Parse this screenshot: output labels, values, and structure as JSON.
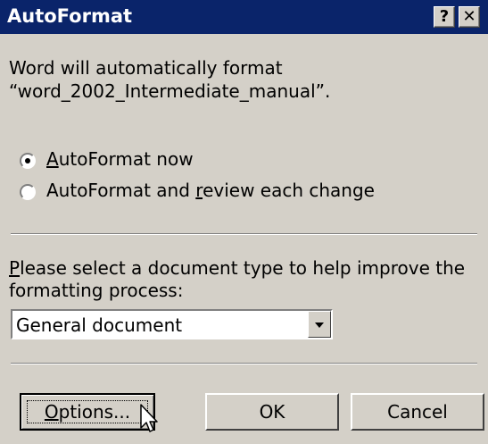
{
  "window": {
    "title": "AutoFormat",
    "help_label": "?",
    "close_label": "✕"
  },
  "intro": {
    "line1": "Word will automatically format",
    "line2": "“word_2002_Intermediate_manual”."
  },
  "options": [
    {
      "pre": "",
      "key": "A",
      "post": "utoFormat now",
      "selected": true
    },
    {
      "pre": "AutoFormat and ",
      "key": "r",
      "post": "eview each change",
      "selected": false
    }
  ],
  "doctype": {
    "label_key": "P",
    "label_rest": "lease select a document type to help improve the",
    "label_line2": "formatting process:",
    "selected": "General document"
  },
  "buttons": {
    "options_key": "O",
    "options_rest": "ptions...",
    "ok": "OK",
    "cancel": "Cancel"
  }
}
